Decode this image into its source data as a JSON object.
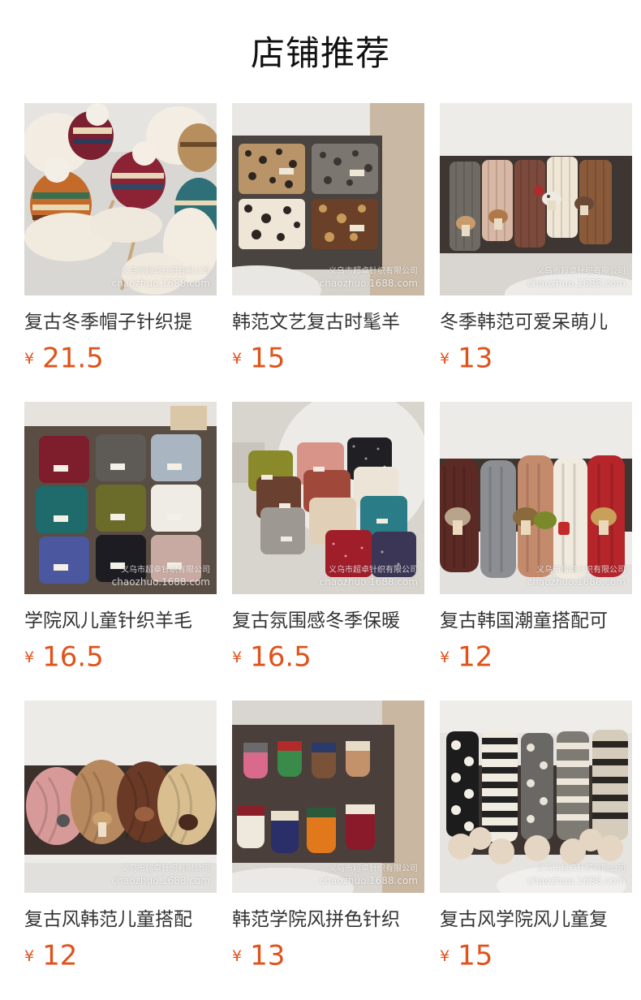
{
  "header": {
    "title": "店铺推荐"
  },
  "accent_color": "#e0521a",
  "watermark": {
    "line1": "义乌市超卓针织有限公司",
    "line2": "chaozhuo.1688.com"
  },
  "products": [
    {
      "name": "复古冬季帽子针织提",
      "currency": "¥",
      "price": "21.5",
      "image": "white faux-fur earflap hats with fair-isle knit pom-pom beanies"
    },
    {
      "name": "韩范文艺复古时髦羊",
      "currency": "¥",
      "price": "15",
      "image": "four leopard-print knit scarves laid on a table"
    },
    {
      "name": "冬季韩范可爱呆萌儿",
      "currency": "¥",
      "price": "13",
      "image": "five ribbed scarves with mushroom toppers on a dark table"
    },
    {
      "name": "学院风儿童针织羊毛",
      "currency": "¥",
      "price": "16.5",
      "image": "nine cable-knit scarves in a grid with white labels"
    },
    {
      "name": "复古氛围感冬季保暖",
      "currency": "¥",
      "price": "16.5",
      "image": "speckled knit scarves in assorted colors on a round rug"
    },
    {
      "name": "复古韩国潮童搭配可",
      "currency": "¥",
      "price": "12",
      "image": "five chunky scarves with mushroom toppers hanging over a table"
    },
    {
      "name": "复古风韩范儿童搭配",
      "currency": "¥",
      "price": "12",
      "image": "twisted neck scarves with mushroom pins"
    },
    {
      "name": "韩范学院风拼色针织",
      "currency": "¥",
      "price": "13",
      "image": "children's knit gloves with colored cuffs on a table"
    },
    {
      "name": "复古风学院风儿童复",
      "currency": "¥",
      "price": "15",
      "image": "polka-dot and striped scarves with fluffy pom-poms"
    }
  ]
}
